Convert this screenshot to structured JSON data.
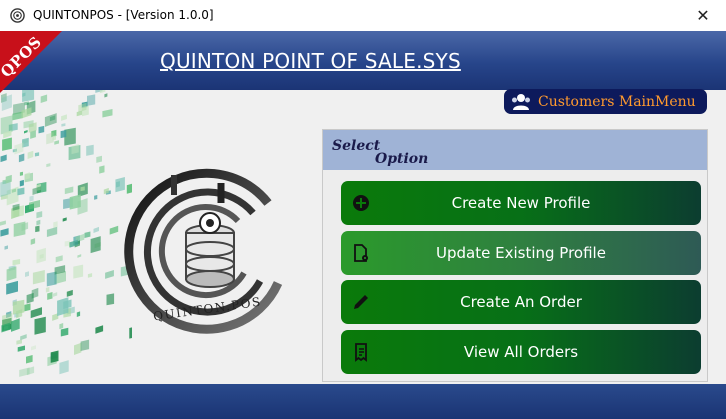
{
  "window": {
    "title": "QUINTONPOS - [Version 1.0.0]",
    "close_glyph": "✕"
  },
  "header": {
    "title": "QUINTON POINT OF SALE.SYS",
    "corner_badge": "QPOS"
  },
  "customers_button": {
    "label": "Customers MainMenu",
    "icon": "users-icon"
  },
  "logo": {
    "text": "QUINTON.POS"
  },
  "panel": {
    "heading_line1": "Select",
    "heading_line2": "Option",
    "options": [
      {
        "label": "Create New Profile",
        "icon": "plus-circle-icon"
      },
      {
        "label": "Update Existing Profile",
        "icon": "file-gear-icon"
      },
      {
        "label": "Create An Order",
        "icon": "pencil-icon"
      },
      {
        "label": "View All Orders",
        "icon": "receipt-icon"
      }
    ]
  },
  "colors": {
    "header_blue": "#27458a",
    "corner_red": "#c8101a",
    "button_green": "#077017",
    "button_dark": "#0c3d30",
    "customers_bg": "#0d1a5c",
    "customers_text": "#ff9a2e",
    "panel_head": "#9fb3d6"
  }
}
